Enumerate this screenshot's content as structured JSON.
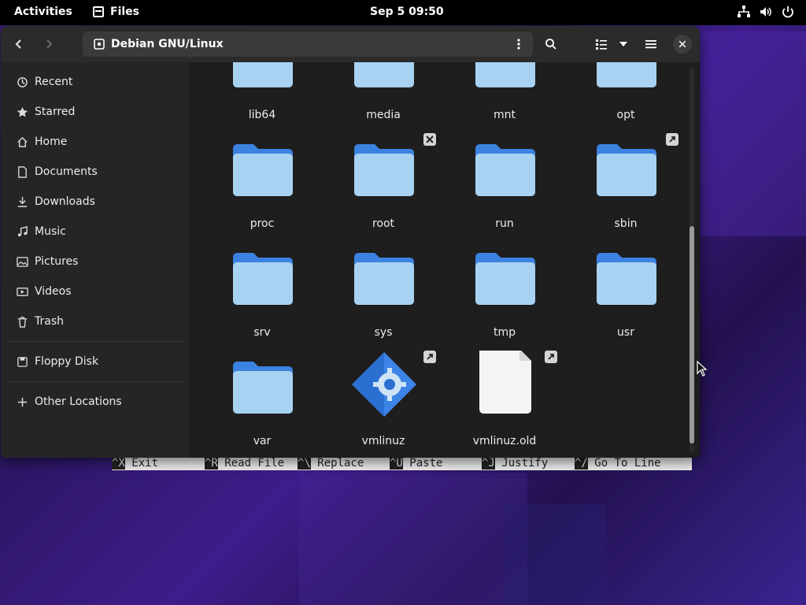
{
  "topbar": {
    "activities": "Activities",
    "app_name": "Files",
    "clock": "Sep 5  09:50",
    "tray_icons": [
      "network-icon",
      "volume-icon",
      "power-icon"
    ]
  },
  "headerbar": {
    "location": "Debian GNU/Linux"
  },
  "sidebar": {
    "items": [
      {
        "label": "Recent",
        "icon": "clock-icon"
      },
      {
        "label": "Starred",
        "icon": "star-icon"
      },
      {
        "label": "Home",
        "icon": "home-icon"
      },
      {
        "label": "Documents",
        "icon": "document-icon"
      },
      {
        "label": "Downloads",
        "icon": "download-icon"
      },
      {
        "label": "Music",
        "icon": "music-icon"
      },
      {
        "label": "Pictures",
        "icon": "picture-icon"
      },
      {
        "label": "Videos",
        "icon": "video-icon"
      },
      {
        "label": "Trash",
        "icon": "trash-icon"
      }
    ],
    "devices": [
      {
        "label": "Floppy Disk",
        "icon": "floppy-icon"
      }
    ],
    "other": {
      "label": "Other Locations",
      "icon": "plus-icon"
    }
  },
  "files": [
    {
      "name": "lib64",
      "type": "folder"
    },
    {
      "name": "media",
      "type": "folder"
    },
    {
      "name": "mnt",
      "type": "folder"
    },
    {
      "name": "opt",
      "type": "folder"
    },
    {
      "name": "proc",
      "type": "folder"
    },
    {
      "name": "root",
      "type": "folder",
      "emblem": "locked-emblem"
    },
    {
      "name": "run",
      "type": "folder"
    },
    {
      "name": "sbin",
      "type": "folder",
      "emblem": "symlink-emblem"
    },
    {
      "name": "srv",
      "type": "folder"
    },
    {
      "name": "sys",
      "type": "folder"
    },
    {
      "name": "tmp",
      "type": "folder"
    },
    {
      "name": "usr",
      "type": "folder"
    },
    {
      "name": "var",
      "type": "folder"
    },
    {
      "name": "vmlinuz",
      "type": "executable",
      "emblem": "symlink-emblem"
    },
    {
      "name": "vmlinuz.old",
      "type": "file",
      "emblem": "symlink-emblem"
    }
  ],
  "nano": {
    "items": [
      {
        "key": "^X",
        "label": " Exit"
      },
      {
        "key": "^R",
        "label": " Read File"
      },
      {
        "key": "^\\",
        "label": " Replace"
      },
      {
        "key": "^U",
        "label": " Paste"
      },
      {
        "key": "^J",
        "label": " Justify"
      },
      {
        "key": "^/",
        "label": " Go To Line"
      }
    ]
  },
  "colors": {
    "folder_top": "#3c82e0",
    "folder_body": "#a8d2f2",
    "accent": "#3584e4"
  }
}
